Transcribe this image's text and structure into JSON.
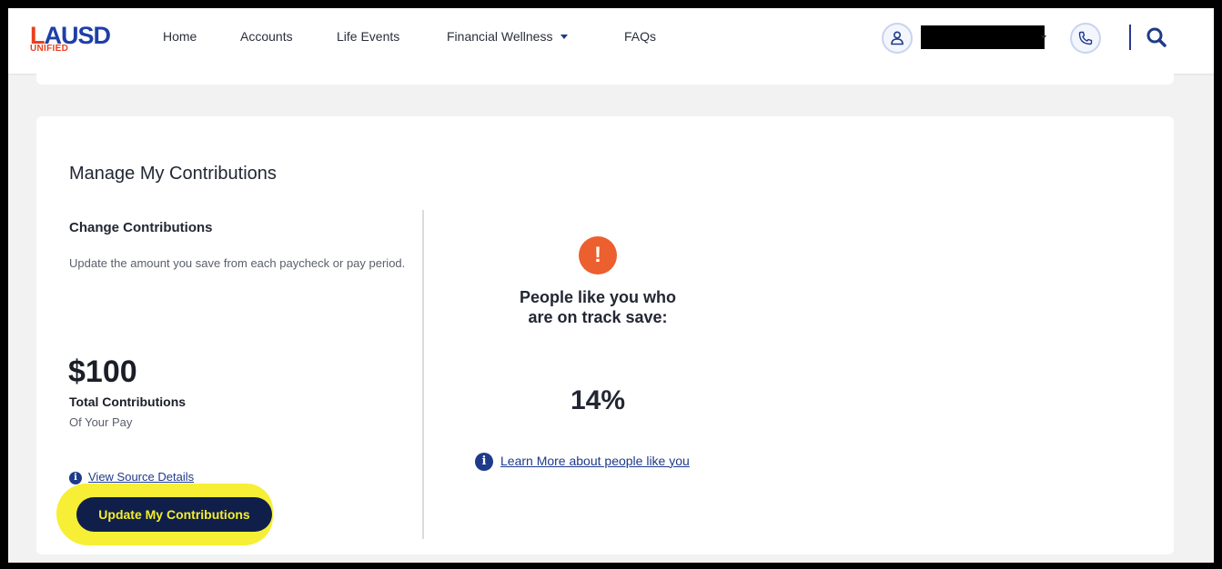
{
  "brand": {
    "logo_main_a": "L",
    "logo_main_b": "AUSD",
    "logo_sub": "UNIFIED",
    "accent": "#e8401c",
    "primary": "#1e3a8a"
  },
  "nav": {
    "items": [
      {
        "label": "Home"
      },
      {
        "label": "Accounts"
      },
      {
        "label": "Life Events"
      },
      {
        "label": "Financial Wellness",
        "has_dropdown": true
      },
      {
        "label": "FAQs"
      }
    ]
  },
  "header_icons": [
    "user-icon",
    "phone-icon",
    "search-icon"
  ],
  "contributions": {
    "title": "Manage My Contributions",
    "section_title": "Change Contributions",
    "description": "Update the amount you save from each paycheck or pay period.",
    "amount": "$100",
    "total_label": "Total Contributions",
    "total_sub": "Of Your Pay",
    "view_source_link": "View Source Details",
    "update_button": "Update My Contributions"
  },
  "benchmark": {
    "alert_symbol": "!",
    "people_text_line1": "People like you who",
    "people_text_line2": "are on track save:",
    "percent": "14%",
    "learn_more_link": "Learn More about people like you"
  }
}
